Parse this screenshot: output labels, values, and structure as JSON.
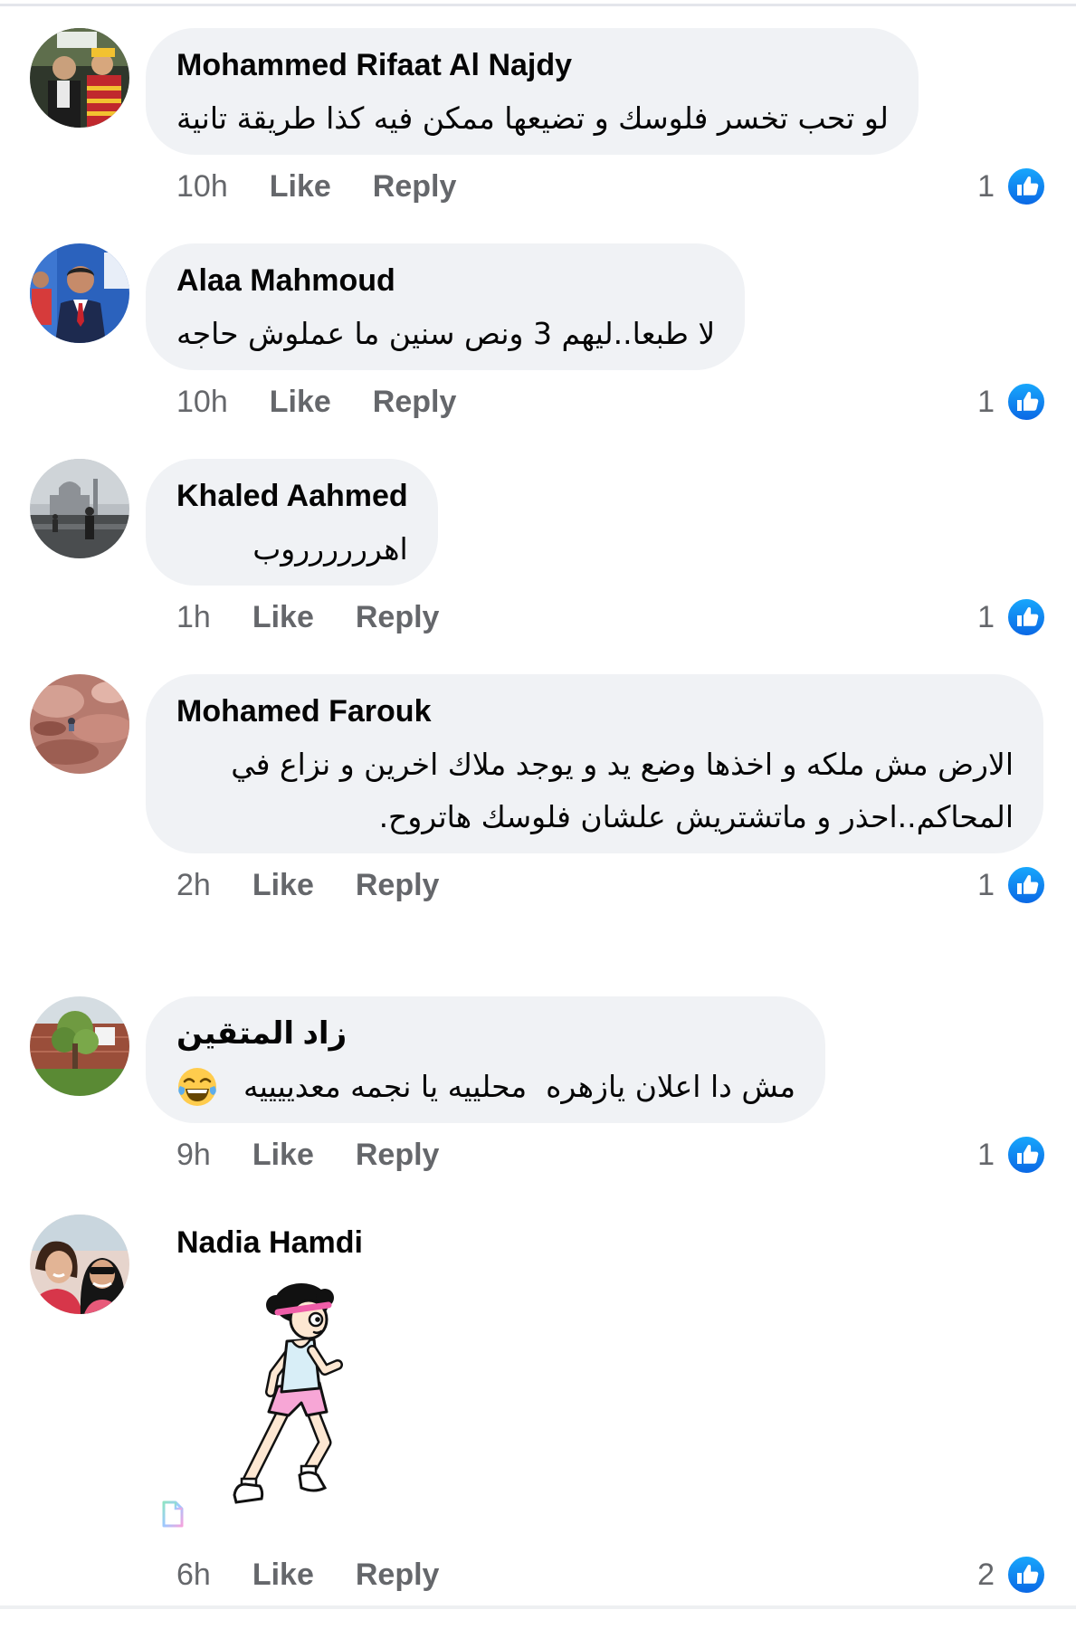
{
  "comments": [
    {
      "author": "Mohammed Rifaat Al Najdy",
      "text": "لو تحب تخسر فلوسك و تضيعها ممكن فيه كذا طريقة تانية",
      "time": "10h",
      "like_label": "Like",
      "reply_label": "Reply",
      "reaction_count": "1"
    },
    {
      "author": "Alaa Mahmoud",
      "text": "لا طبعا..ليهم 3 ونص سنين ما عملوش حاجه",
      "time": "10h",
      "like_label": "Like",
      "reply_label": "Reply",
      "reaction_count": "1"
    },
    {
      "author": "Khaled Aahmed",
      "text": "اهرررررروب",
      "time": "1h",
      "like_label": "Like",
      "reply_label": "Reply",
      "reaction_count": "1"
    },
    {
      "author": "Mohamed Farouk",
      "text": "الارض مش ملكه و اخذها وضع يد و يوجد ملاك اخرين و نزاع في المحاكم..احذر و ماتشتريش علشان فلوسك هاتروح.",
      "time": "2h",
      "like_label": "Like",
      "reply_label": "Reply",
      "reaction_count": "1"
    },
    {
      "author": "زاد المتقين",
      "text": "مش دا اعلان يازهره  محلييه يا نجمه معدييييه",
      "emoji": "face-with-tears-of-joy",
      "time": "9h",
      "like_label": "Like",
      "reply_label": "Reply",
      "reaction_count": "1"
    },
    {
      "author": "Nadia Hamdi",
      "sticker": "running-cartoon-sticker",
      "time": "6h",
      "like_label": "Like",
      "reply_label": "Reply",
      "reaction_count": "2"
    }
  ],
  "reaction_icon": "like-thumb-icon",
  "colors": {
    "bubble": "#f0f2f5",
    "text": "#050505",
    "meta": "#65676b",
    "like_blue": "#1877f2"
  }
}
